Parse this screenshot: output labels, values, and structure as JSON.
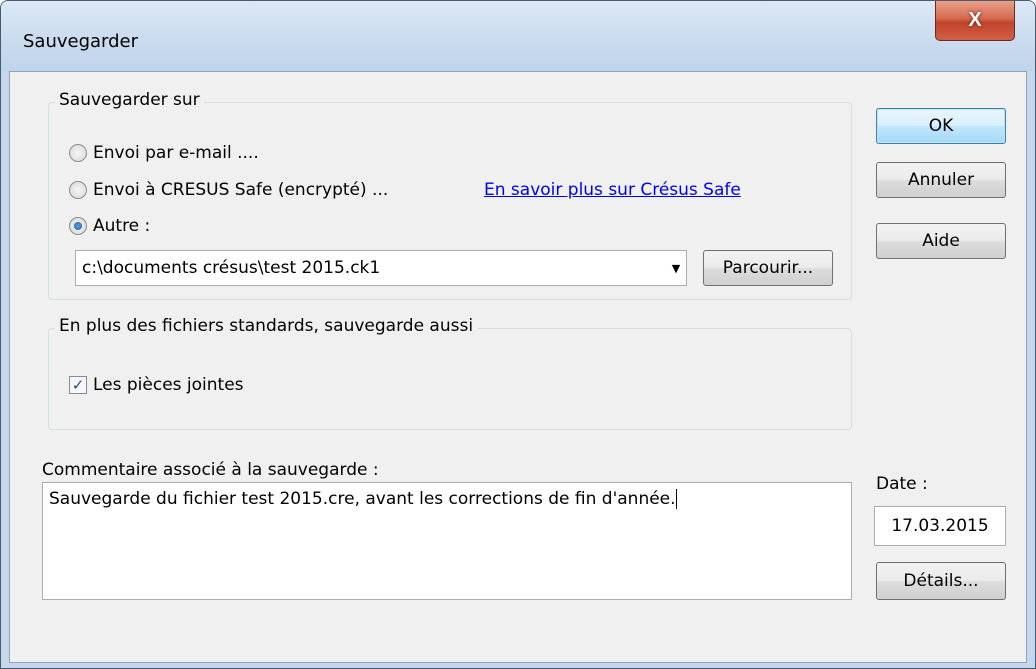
{
  "window": {
    "title": "Sauvegarder",
    "close_label": "X"
  },
  "save_to": {
    "legend": "Sauvegarder sur",
    "options": [
      {
        "label": "Envoi par e-mail ....",
        "checked": false
      },
      {
        "label": "Envoi à CRESUS Safe (encrypté) ...",
        "checked": false
      },
      {
        "label": "Autre :",
        "checked": true
      }
    ],
    "safe_link": "En savoir plus sur Crésus Safe",
    "path_value": "c:\\documents crésus\\test 2015.ck1",
    "browse_label": "Parcourir..."
  },
  "extras": {
    "legend": "En plus des fichiers standards, sauvegarde aussi",
    "attachments_label": "Les pièces jointes",
    "attachments_checked": true
  },
  "comment": {
    "label": "Commentaire associé à la sauvegarde :",
    "value": "Sauvegarde du fichier test 2015.cre, avant les corrections de fin d'année."
  },
  "date": {
    "label": "Date :",
    "value": "17.03.2015"
  },
  "buttons": {
    "ok": "OK",
    "cancel": "Annuler",
    "help": "Aide",
    "details": "Détails..."
  }
}
